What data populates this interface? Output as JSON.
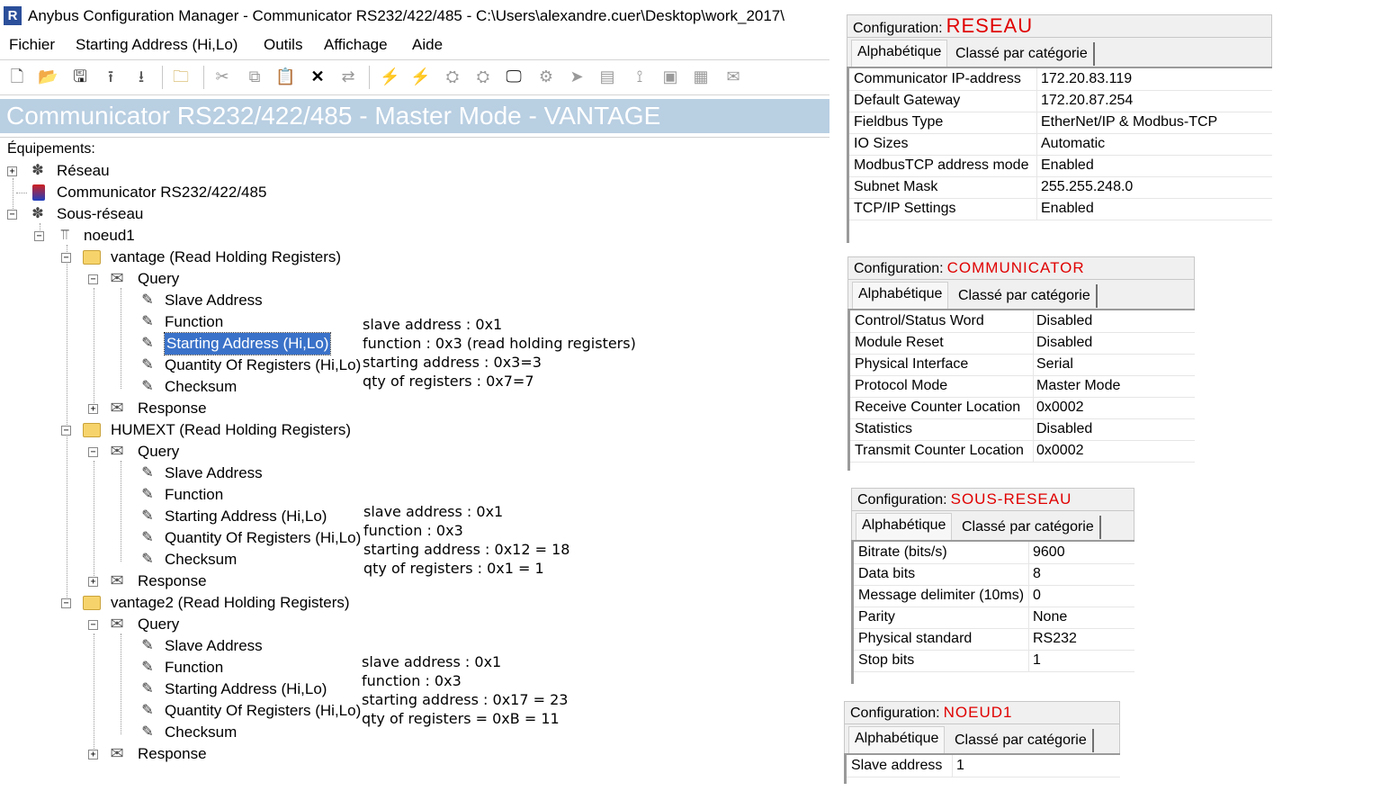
{
  "window": {
    "title": "Anybus Configuration Manager - Communicator RS232/422/485  - C:\\Users\\alexandre.cuer\\Desktop\\work_2017\\",
    "app_icon_letter": "R"
  },
  "menu": [
    "Fichier",
    "Starting Address (Hi,Lo)",
    "Outils",
    "Affichage",
    "Aide"
  ],
  "banner": "Communicator RS232/422/485 - Master Mode - VANTAGE",
  "tree": {
    "header": "Équipements:",
    "reseau": "Réseau",
    "communicator": "Communicator RS232/422/485",
    "sous_reseau": "Sous-réseau",
    "noeud1": "noeud1",
    "transactions": [
      {
        "name": "vantage (Read Holding Registers)",
        "query": "Query",
        "fields": [
          "Slave Address",
          "Function",
          "Starting Address (Hi,Lo)",
          "Quantity Of Registers (Hi,Lo)",
          "Checksum"
        ],
        "response": "Response"
      },
      {
        "name": "HUMEXT (Read Holding Registers)",
        "query": "Query",
        "fields": [
          "Slave Address",
          "Function",
          "Starting Address (Hi,Lo)",
          "Quantity Of Registers (Hi,Lo)",
          "Checksum"
        ],
        "response": "Response"
      },
      {
        "name": "vantage2 (Read Holding Registers)",
        "query": "Query",
        "fields": [
          "Slave Address",
          "Function",
          "Starting Address (Hi,Lo)",
          "Quantity Of Registers (Hi,Lo)",
          "Checksum"
        ],
        "response": "Response"
      }
    ]
  },
  "annotations": [
    [
      "slave address : 0x1",
      "function : 0x3 (read holding registers)",
      "starting address : 0x3=3",
      "qty of registers : 0x7=7"
    ],
    [
      "slave address : 0x1",
      "function : 0x3",
      "starting address : 0x12 = 18",
      "qty of registers : 0x1 = 1"
    ],
    [
      "slave address : 0x1",
      "function : 0x3",
      "starting address : 0x17 = 23",
      "qty of registers = 0xB = 11"
    ]
  ],
  "panels": [
    {
      "label": "Configuration:",
      "name": "RESEAU",
      "tabs": [
        "Alphabétique",
        "Classé par catégorie"
      ],
      "rows": [
        [
          "Communicator IP-address",
          "172.20.83.119"
        ],
        [
          "Default Gateway",
          "172.20.87.254"
        ],
        [
          "Fieldbus Type",
          "EtherNet/IP & Modbus-TCP"
        ],
        [
          "IO Sizes",
          "Automatic"
        ],
        [
          "ModbusTCP address mode",
          "Enabled"
        ],
        [
          "Subnet Mask",
          "255.255.248.0"
        ],
        [
          "TCP/IP Settings",
          "Enabled"
        ]
      ]
    },
    {
      "label": "Configuration:",
      "name": "COMMUNICATOR",
      "tabs": [
        "Alphabétique",
        "Classé par catégorie"
      ],
      "rows": [
        [
          "Control/Status Word",
          "Disabled"
        ],
        [
          "Module Reset",
          "Disabled"
        ],
        [
          "Physical Interface",
          "Serial"
        ],
        [
          "Protocol Mode",
          "Master Mode"
        ],
        [
          "Receive Counter Location",
          "0x0002"
        ],
        [
          "Statistics",
          "Disabled"
        ],
        [
          "Transmit Counter Location",
          "0x0002"
        ]
      ]
    },
    {
      "label": "Configuration:",
      "name": "SOUS-RESEAU",
      "tabs": [
        "Alphabétique",
        "Classé par catégorie"
      ],
      "rows": [
        [
          "Bitrate (bits/s)",
          "9600"
        ],
        [
          "Data bits",
          "8"
        ],
        [
          "Message delimiter (10ms)",
          "0"
        ],
        [
          "Parity",
          "None"
        ],
        [
          "Physical standard",
          "RS232"
        ],
        [
          "Stop bits",
          "1"
        ]
      ]
    },
    {
      "label": "Configuration:",
      "name": "NOEUD1",
      "tabs": [
        "Alphabétique",
        "Classé par catégorie"
      ],
      "rows": [
        [
          "Slave address",
          "1"
        ]
      ]
    }
  ],
  "colors": {
    "banner_bg": "#b9cfe2",
    "selection": "#3a72c9",
    "config_name": "#e00000"
  }
}
